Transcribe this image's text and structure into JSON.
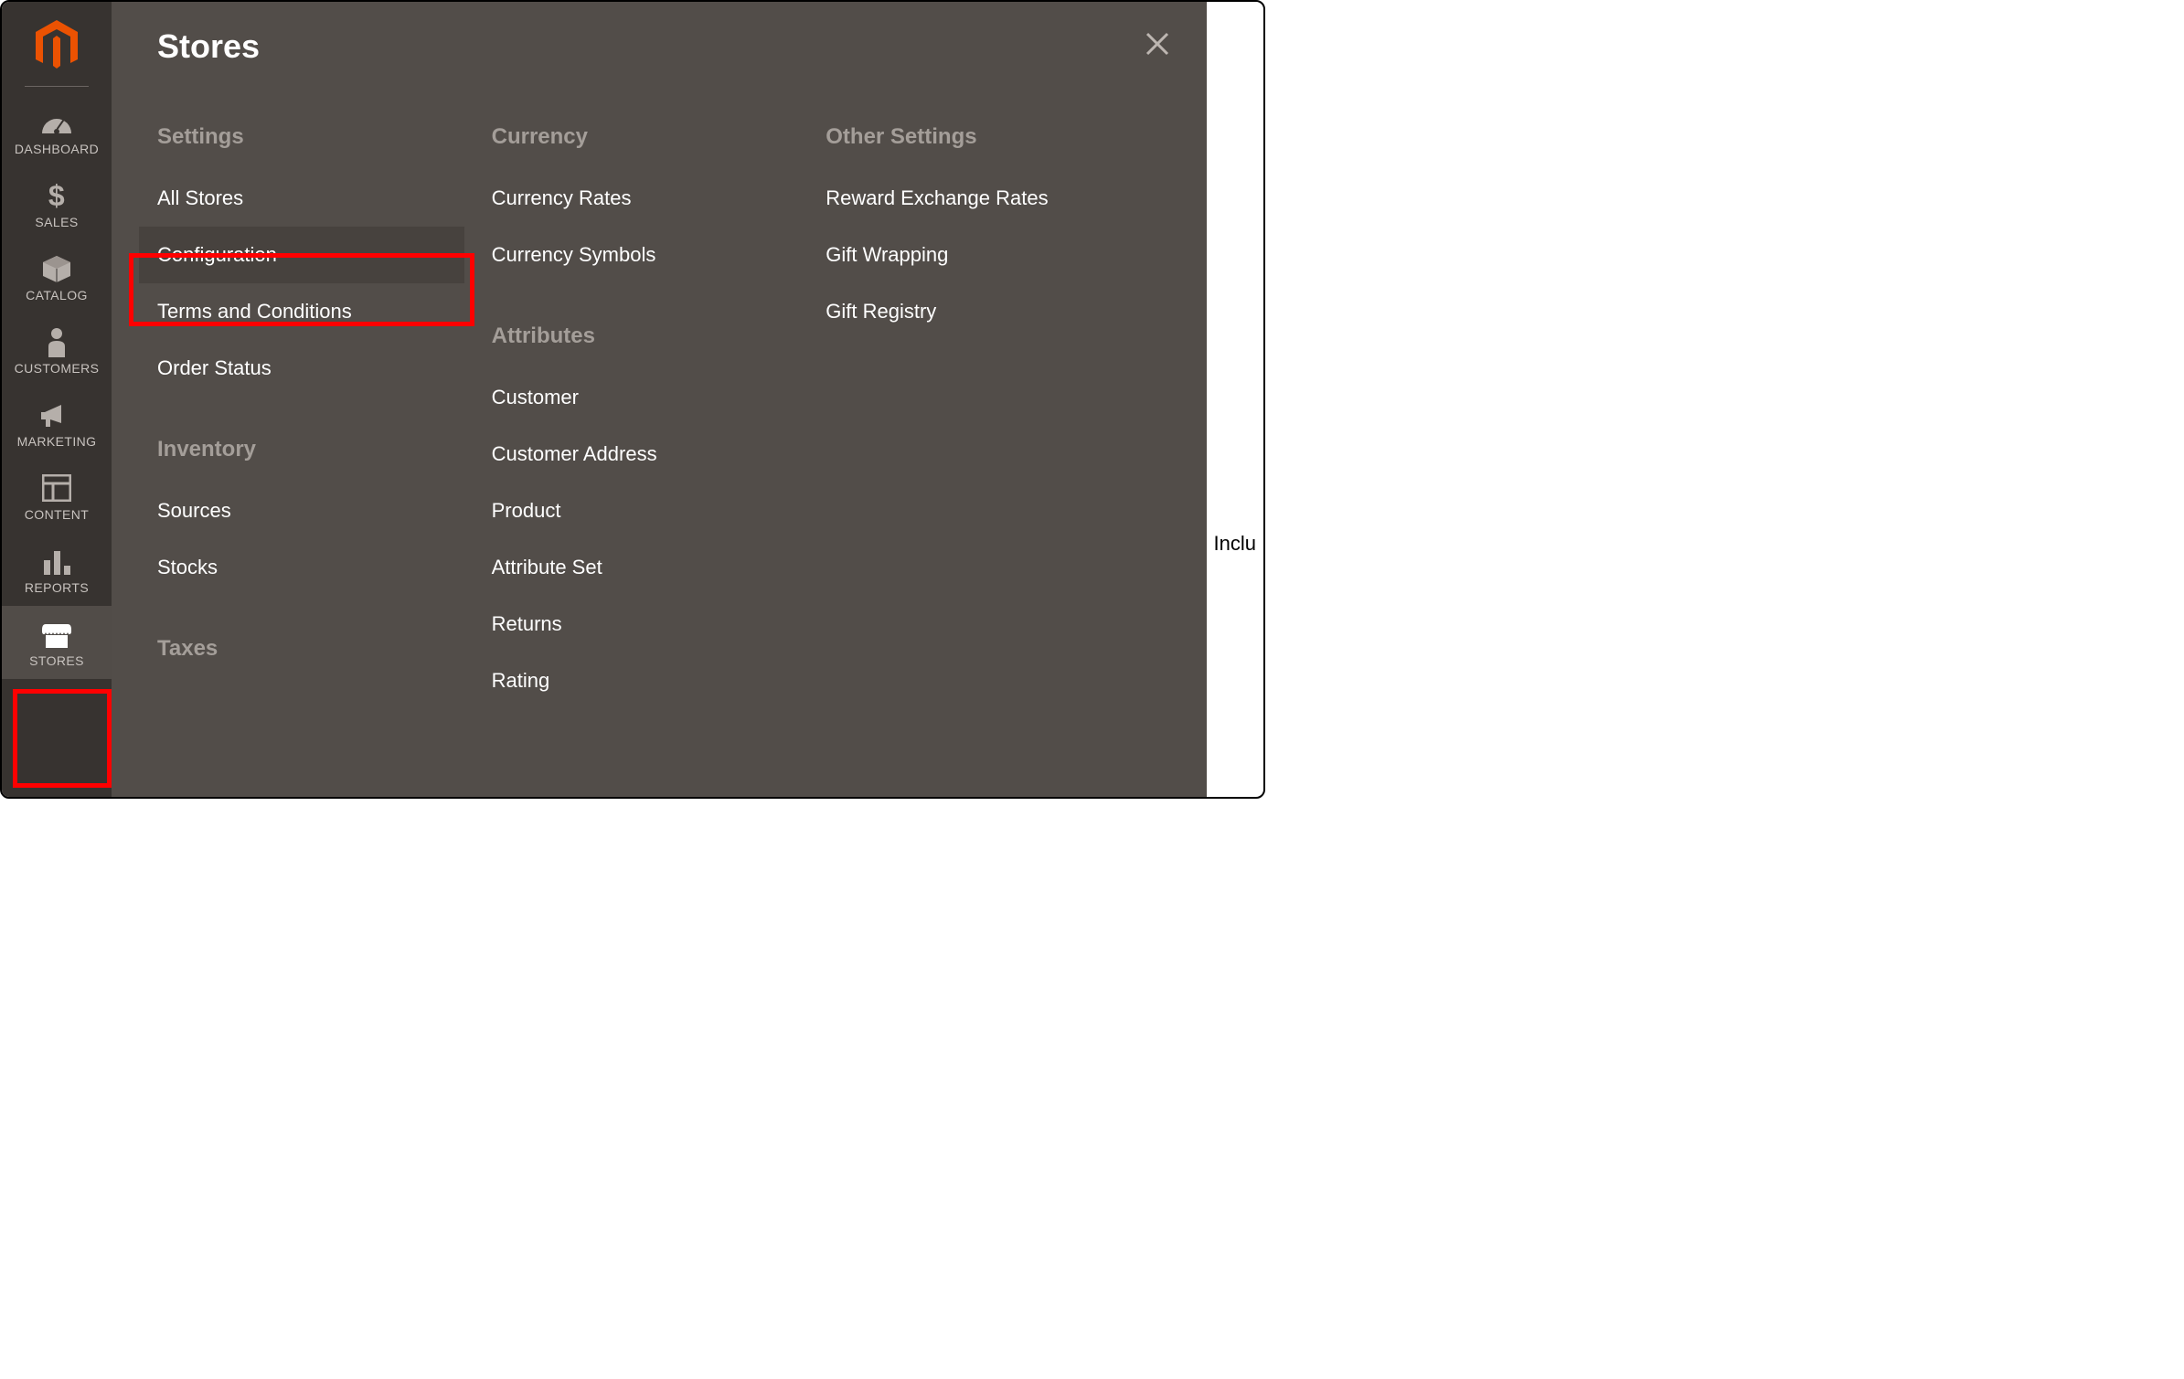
{
  "sidebar": {
    "items": [
      {
        "label": "DASHBOARD"
      },
      {
        "label": "SALES"
      },
      {
        "label": "CATALOG"
      },
      {
        "label": "CUSTOMERS"
      },
      {
        "label": "MARKETING"
      },
      {
        "label": "CONTENT"
      },
      {
        "label": "REPORTS"
      },
      {
        "label": "STORES"
      }
    ]
  },
  "overlay": {
    "title": "Stores",
    "columns": [
      {
        "groups": [
          {
            "title": "Settings",
            "links": [
              "All Stores",
              "Configuration",
              "Terms and Conditions",
              "Order Status"
            ]
          },
          {
            "title": "Inventory",
            "links": [
              "Sources",
              "Stocks"
            ]
          },
          {
            "title": "Taxes",
            "links": []
          }
        ]
      },
      {
        "groups": [
          {
            "title": "Currency",
            "links": [
              "Currency Rates",
              "Currency Symbols"
            ]
          },
          {
            "title": "Attributes",
            "links": [
              "Customer",
              "Customer Address",
              "Product",
              "Attribute Set",
              "Returns",
              "Rating"
            ]
          }
        ]
      },
      {
        "groups": [
          {
            "title": "Other Settings",
            "links": [
              "Reward Exchange Rates",
              "Gift Wrapping",
              "Gift Registry"
            ]
          }
        ]
      }
    ]
  },
  "background": {
    "peek_text": "Inclu"
  }
}
